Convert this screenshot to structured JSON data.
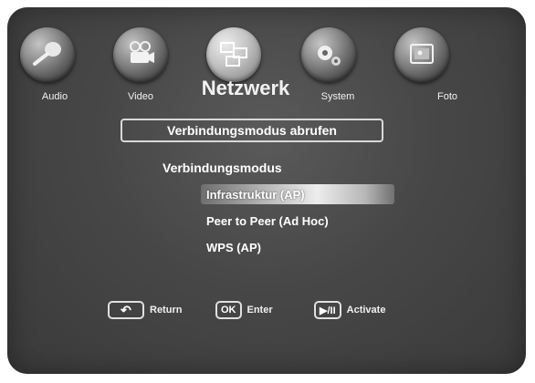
{
  "tabs": [
    {
      "id": "audio",
      "label": "Audio",
      "icon": "microphone-icon"
    },
    {
      "id": "video",
      "label": "Video",
      "icon": "video-camera-icon"
    },
    {
      "id": "network",
      "label": "Netzwerk",
      "icon": "network-icon",
      "active": true
    },
    {
      "id": "system",
      "label": "System",
      "icon": "gears-icon"
    },
    {
      "id": "photo",
      "label": "Foto",
      "icon": "photo-icon"
    }
  ],
  "header": {
    "title": "Verbindungsmodus abrufen"
  },
  "section": {
    "label": "Verbindungsmodus"
  },
  "options": [
    {
      "label": "Infrastruktur (AP)",
      "selected": true
    },
    {
      "label": "Peer to Peer (Ad Hoc)"
    },
    {
      "label": "WPS (AP)"
    }
  ],
  "footer": {
    "return": {
      "key": "↶",
      "label": "Return"
    },
    "enter": {
      "key": "OK",
      "label": "Enter"
    },
    "activate": {
      "key": "▶/II",
      "label": "Activate"
    }
  }
}
